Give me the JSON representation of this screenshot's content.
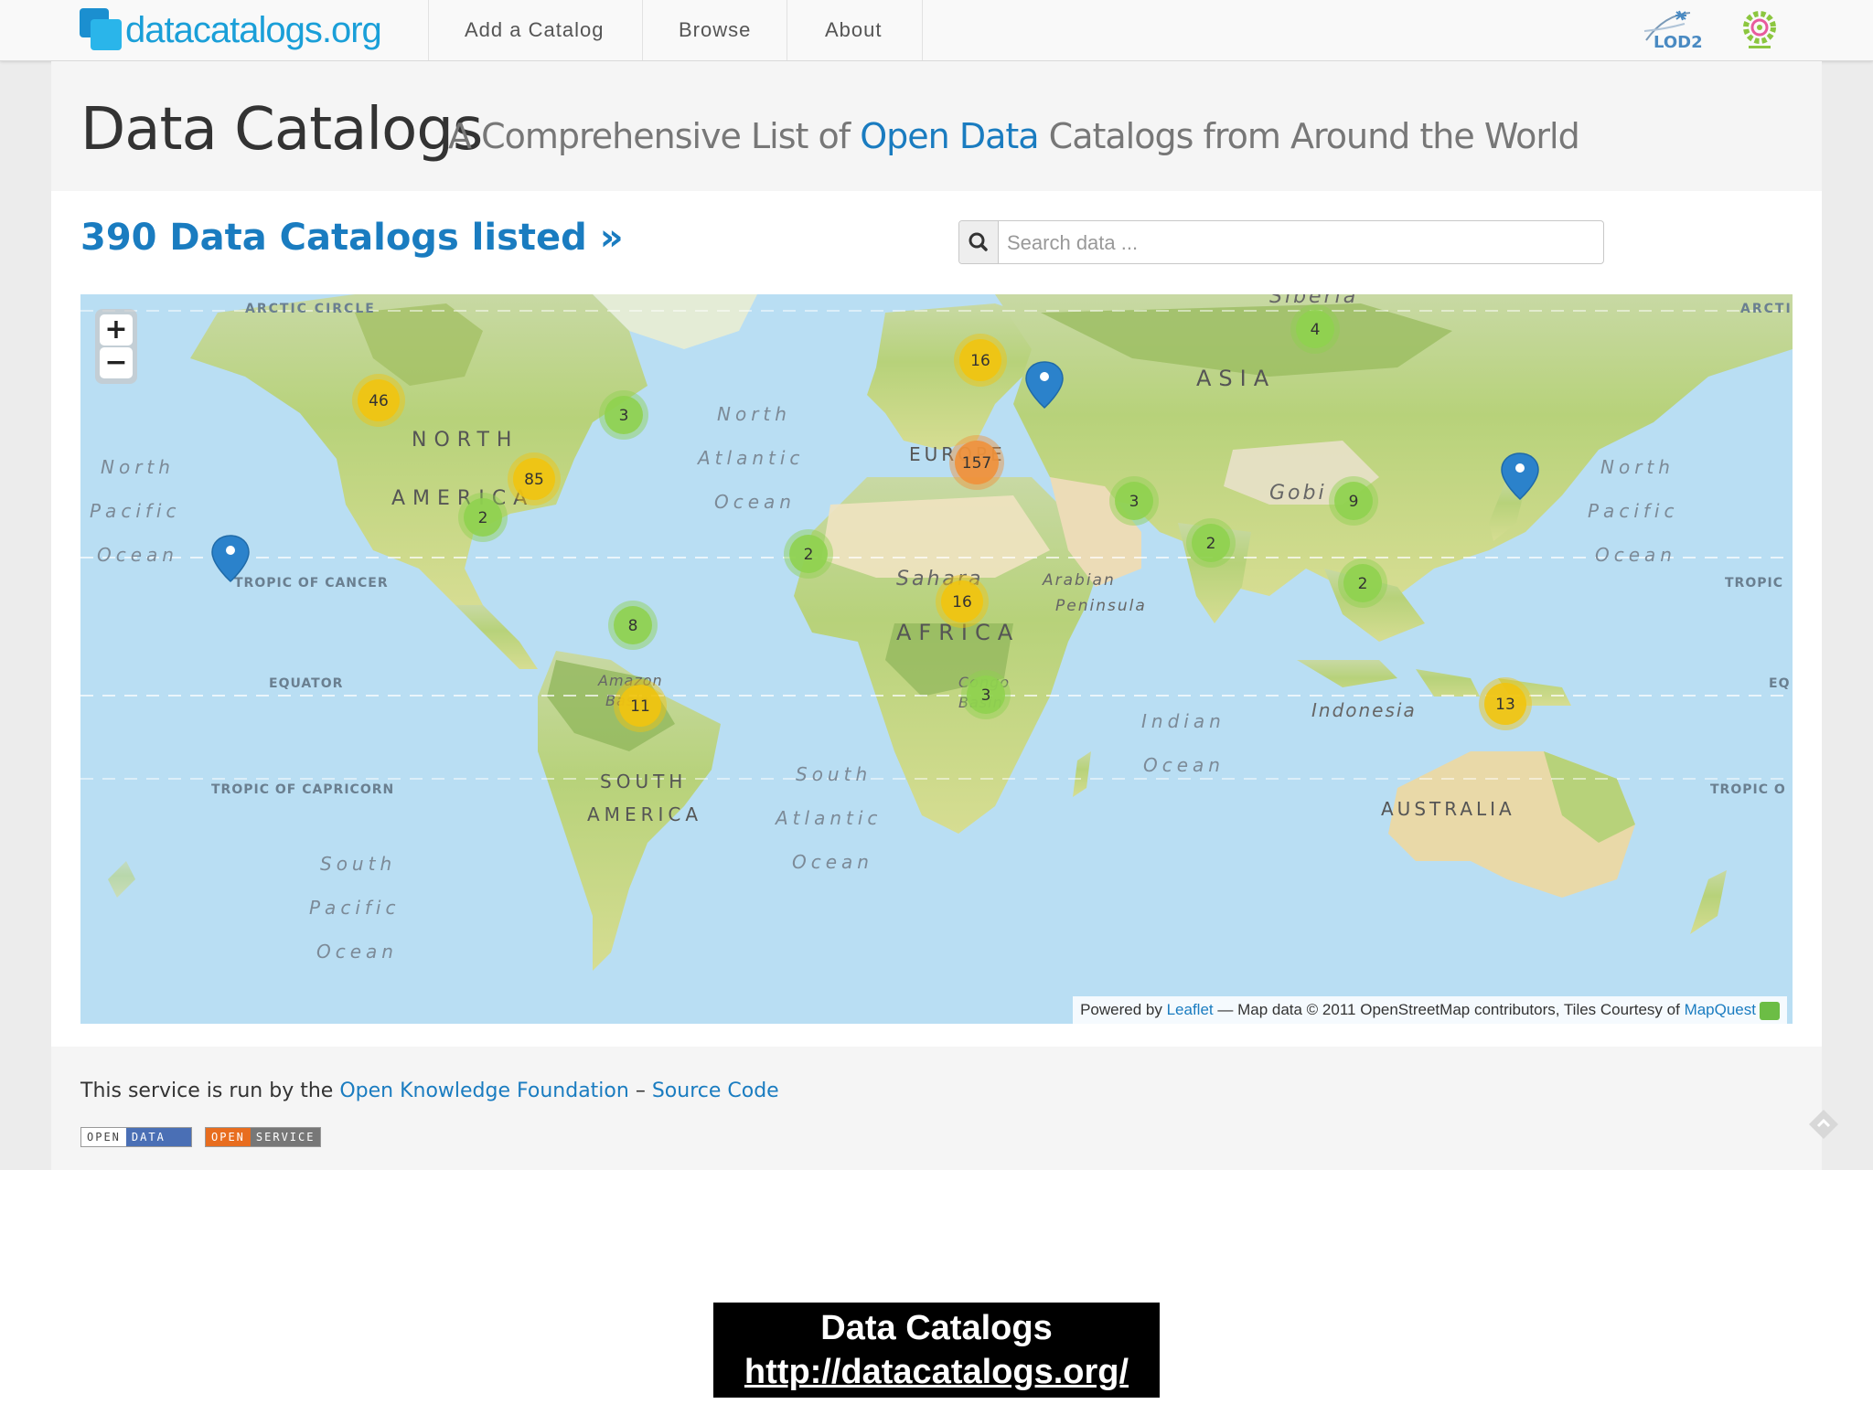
{
  "navbar": {
    "brand": "datacatalogs.org",
    "items": [
      "Add a Catalog",
      "Browse",
      "About"
    ]
  },
  "hero": {
    "title": "Data Catalogs",
    "subtitle_pre": "A Comprehensive List of",
    "subtitle_highlight": "Open Data",
    "subtitle_post": "Catalogs from Around the World"
  },
  "count_link": "390 Data Catalogs listed »",
  "search": {
    "placeholder": "Search data ..."
  },
  "map": {
    "labels": {
      "arctic_circle": "ARCTIC CIRCLE",
      "arctic_right": "ARCTI",
      "siberia": "Siberia",
      "asia": "ASIA",
      "north_america_1": "NORTH",
      "north_america_2": "AMERICA",
      "north_atlantic_1": "North",
      "north_atlantic_2": "Atlantic",
      "north_atlantic_3": "Ocean",
      "europe": "EUROPE",
      "gobi": "Gobi",
      "north_pacific_l1": "North",
      "north_pacific_l2": "Pacific",
      "north_pacific_l3": "Ocean",
      "north_pacific_r1": "North",
      "north_pacific_r2": "Pacific",
      "north_pacific_r3": "Ocean",
      "tropic_cancer": "TROPIC OF CANCER",
      "tropic_right": "TROPIC",
      "sahara": "Sahara",
      "arabian_1": "Arabian",
      "arabian_2": "Peninsula",
      "africa": "AFRICA",
      "equator": "EQUATOR",
      "equator_right": "EQ",
      "amazon_1": "Amazon",
      "amazon_2": "Basin",
      "congo_1": "Congo",
      "congo_2": "Basin",
      "indian_1": "Indian",
      "indian_2": "Ocean",
      "indonesia": "Indonesia",
      "tropic_capricorn": "TROPIC OF CAPRICORN",
      "tropic_cap_right": "TROPIC O",
      "south_america_1": "SOUTH",
      "south_america_2": "AMERICA",
      "south_atlantic_1": "South",
      "south_atlantic_2": "Atlantic",
      "south_atlantic_3": "Ocean",
      "australia": "AUSTRALIA",
      "south_pacific_1": "South",
      "south_pacific_2": "Pacific",
      "south_pacific_3": "Ocean"
    },
    "clusters": [
      {
        "id": "north-america-west",
        "count": "46",
        "color": "#f1c40f"
      },
      {
        "id": "north-america-east",
        "count": "85",
        "color": "#f1c40f"
      },
      {
        "id": "canada-east",
        "count": "3",
        "color": "#8fd14f"
      },
      {
        "id": "mexico",
        "count": "2",
        "color": "#8fd14f"
      },
      {
        "id": "europe-north",
        "count": "16",
        "color": "#f1c40f"
      },
      {
        "id": "europe",
        "count": "157",
        "color": "#f0913a"
      },
      {
        "id": "siberia",
        "count": "4",
        "color": "#8fd14f"
      },
      {
        "id": "middle-east",
        "count": "3",
        "color": "#8fd14f"
      },
      {
        "id": "india",
        "count": "2",
        "color": "#8fd14f"
      },
      {
        "id": "china",
        "count": "9",
        "color": "#8fd14f"
      },
      {
        "id": "west-africa",
        "count": "2",
        "color": "#8fd14f"
      },
      {
        "id": "central-africa",
        "count": "16",
        "color": "#f1c40f"
      },
      {
        "id": "south-africa",
        "count": "3",
        "color": "#8fd14f"
      },
      {
        "id": "amazon",
        "count": "8",
        "color": "#8fd14f"
      },
      {
        "id": "south-america",
        "count": "11",
        "color": "#f1c40f"
      },
      {
        "id": "indonesia",
        "count": "2",
        "color": "#8fd14f"
      },
      {
        "id": "australia",
        "count": "13",
        "color": "#f1c40f"
      }
    ],
    "zoom_in": "+",
    "zoom_out": "−",
    "attribution": {
      "powered": "Powered by",
      "leaflet": "Leaflet",
      "mid": "— Map data © 2011 OpenStreetMap contributors, Tiles Courtesy of",
      "mapquest": "MapQuest"
    }
  },
  "footer": {
    "pre": "This service is run by the",
    "okf": "Open Knowledge Foundation",
    "dash": "–",
    "source": "Source Code",
    "badge1_a": "OPEN",
    "badge1_b": "DATA",
    "badge2_a": "OPEN",
    "badge2_b": "SERVICE"
  },
  "caption": {
    "title": "Data Catalogs",
    "url": "http://datacatalogs.org/"
  },
  "colors": {
    "link": "#1a7cc0",
    "brand": "#1a9fd8",
    "ocean": "#b7dcf2",
    "land": "#d5e79a",
    "cluster_small": "#8fd14f",
    "cluster_medium": "#f1c40f",
    "cluster_large": "#f0913a",
    "marker": "#2b82cb"
  }
}
